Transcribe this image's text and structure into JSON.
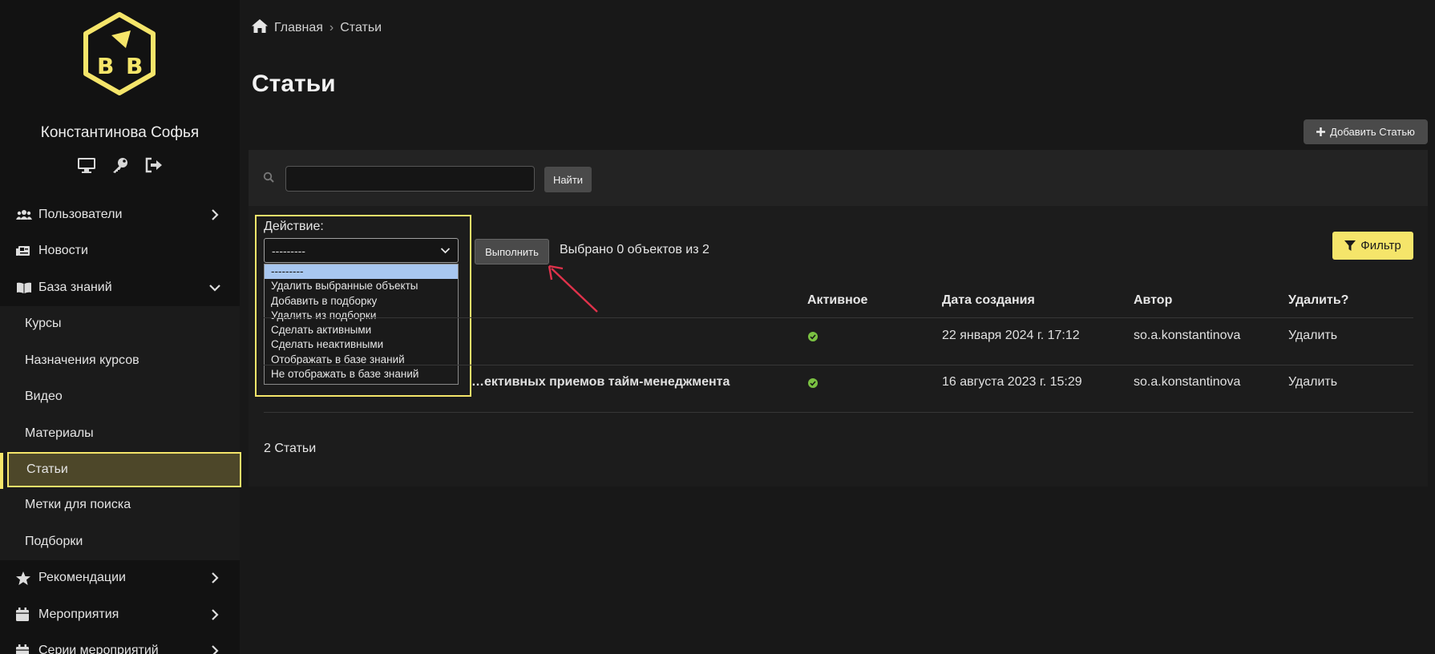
{
  "sidebar": {
    "user_name": "Константинова Софья",
    "user_icons": [
      "monitor-icon",
      "key-icon",
      "logout-icon"
    ],
    "items": [
      {
        "label": "Пользователи",
        "icon": "users-icon",
        "arrow": "chevron-right"
      },
      {
        "label": "Новости",
        "icon": "newspaper-icon",
        "arrow": ""
      },
      {
        "label": "База знаний",
        "icon": "book-icon",
        "arrow": "chevron-down"
      },
      {
        "label": "Курсы"
      },
      {
        "label": "Назначения курсов"
      },
      {
        "label": "Видео"
      },
      {
        "label": "Материалы"
      },
      {
        "label": "Статьи"
      },
      {
        "label": "Метки для поиска"
      },
      {
        "label": "Подборки"
      },
      {
        "label": "Рекомендации",
        "icon": "star-icon",
        "arrow": "chevron-right"
      },
      {
        "label": "Мероприятия",
        "icon": "calendar-icon",
        "arrow": "chevron-right"
      },
      {
        "label": "Серии мероприятий",
        "icon": "calendar-icon",
        "arrow": "chevron-right"
      }
    ]
  },
  "breadcrumb": {
    "home": "Главная",
    "separator": "›",
    "current": "Статьи"
  },
  "page_title": "Статьи",
  "add_button": "Добавить Статью",
  "search": {
    "value": "",
    "button": "Найти"
  },
  "actions": {
    "label": "Действие:",
    "selected": "---------",
    "options": [
      "---------",
      "Удалить выбранные объекты",
      "Добавить в подборку",
      "Удалить из подборки",
      "Сделать активными",
      "Сделать неактивными",
      "Отображать в базе знаний",
      "Не отображать в базе знаний"
    ],
    "run_button": "Выполнить",
    "selected_count": "Выбрано 0 объектов из 2"
  },
  "filter_button": "Фильтр",
  "table": {
    "headers": {
      "active": "Активное",
      "created": "Дата создания",
      "author": "Автор",
      "delete": "Удалить?"
    },
    "rows": [
      {
        "title": "",
        "active": true,
        "created": "22 января 2024 г. 17:12",
        "author": "so.a.konstantinova",
        "delete": "Удалить"
      },
      {
        "title": "…ективных приемов тайм-менеджмента",
        "active": true,
        "created": "16 августа 2023 г. 15:29",
        "author": "so.a.konstantinova",
        "delete": "Удалить"
      }
    ]
  },
  "footer_count": "2 Статьи",
  "colors": {
    "accent": "#f5e56a",
    "active_bg": "#4d4729",
    "check": "#7ac142",
    "annotation_arrow": "#e0324b"
  }
}
